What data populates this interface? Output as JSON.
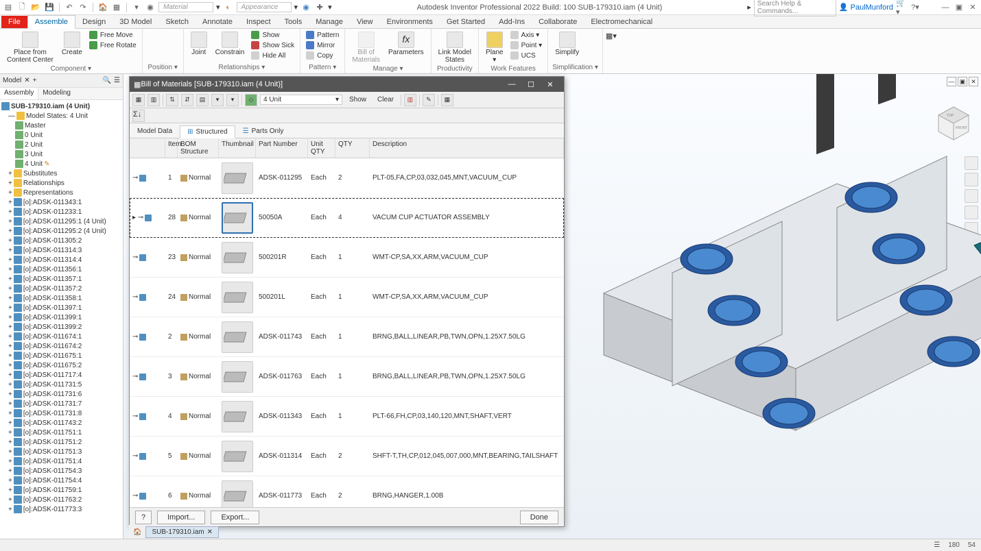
{
  "qat": {
    "material_placeholder": "Material",
    "appearance_label": "Appearance",
    "title": "Autodesk Inventor Professional 2022 Build: 100   SUB-179310.iam (4 Unit)",
    "search_placeholder": "Search Help & Commands...",
    "user": "PaulMunford"
  },
  "tabs": [
    "File",
    "Assemble",
    "Design",
    "3D Model",
    "Sketch",
    "Annotate",
    "Inspect",
    "Tools",
    "Manage",
    "View",
    "Environments",
    "Get Started",
    "Add-Ins",
    "Collaborate",
    "Electromechanical"
  ],
  "active_tab": "Assemble",
  "ribbon": {
    "component": {
      "big": [
        "Place from\nContent Center",
        "Create"
      ],
      "small": [
        "Free Move",
        "Free Rotate"
      ],
      "label": "Component ▾"
    },
    "position": {
      "label": "Position ▾"
    },
    "relationships": {
      "big": [
        "Joint",
        "Constrain"
      ],
      "small": [
        "Show",
        "Show Sick",
        "Hide All"
      ],
      "label": "Relationships ▾"
    },
    "pattern": {
      "small": [
        "Pattern",
        "Mirror",
        "Copy"
      ],
      "label": "Pattern ▾"
    },
    "manage": {
      "big": [
        "Bill of\nMaterials",
        "Parameters"
      ],
      "label": "Manage ▾"
    },
    "productivity": {
      "big": [
        "Link Model\nStates"
      ],
      "label": "Productivity"
    },
    "workfeat": {
      "big": [
        "Plane\n▾"
      ],
      "small": [
        "Axis ▾",
        "Point ▾",
        "UCS"
      ],
      "label": "Work Features"
    },
    "simplify": {
      "big": [
        "Simplify"
      ],
      "label": "Simplification ▾"
    }
  },
  "browser": {
    "head": "Model",
    "tabs": [
      "Assembly",
      "Modeling"
    ],
    "root": "SUB-179310.iam (4 Unit)",
    "modelstates": {
      "label": "Model States: 4 Unit",
      "items": [
        "Master",
        "0 Unit",
        "2 Unit",
        "3 Unit",
        "4 Unit"
      ]
    },
    "folders": [
      "Substitutes",
      "Relationships",
      "Representations"
    ],
    "parts": [
      "[o]:ADSK-011343:1",
      "[o]:ADSK-011233:1",
      "[o]:ADSK-011295:1 (4 Unit)",
      "[o]:ADSK-011295:2 (4 Unit)",
      "[o]:ADSK-011305:2",
      "[o]:ADSK-011314:3",
      "[o]:ADSK-011314:4",
      "[o]:ADSK-011356:1",
      "[o]:ADSK-011357:1",
      "[o]:ADSK-011357:2",
      "[o]:ADSK-011358:1",
      "[o]:ADSK-011397:1",
      "[o]:ADSK-011399:1",
      "[o]:ADSK-011399:2",
      "[o]:ADSK-011674:1",
      "[o]:ADSK-011674:2",
      "[o]:ADSK-011675:1",
      "[o]:ADSK-011675:2",
      "[o]:ADSK-011717:4",
      "[o]:ADSK-011731:5",
      "[o]:ADSK-011731:6",
      "[o]:ADSK-011731:7",
      "[o]:ADSK-011731:8",
      "[o]:ADSK-011743:2",
      "[o]:ADSK-011751:1",
      "[o]:ADSK-011751:2",
      "[o]:ADSK-011751:3",
      "[o]:ADSK-011751:4",
      "[o]:ADSK-011754:3",
      "[o]:ADSK-011754:4",
      "[o]:ADSK-011759:1",
      "[o]:ADSK-011763:2",
      "[o]:ADSK-011773:3"
    ]
  },
  "bom": {
    "title": "Bill of Materials [SUB-179310.iam (4 Unit)]",
    "unit_selector": "4 Unit",
    "show": "Show",
    "clear": "Clear",
    "viewtabs": [
      "Model Data",
      "Structured",
      "Parts Only"
    ],
    "active_view": "Structured",
    "cols": [
      "Item",
      "BOM Structure",
      "Thumbnail",
      "Part Number",
      "Unit QTY",
      "QTY",
      "Description"
    ],
    "rows": [
      {
        "item": "1",
        "bom": "Normal",
        "pn": "ADSK-011295",
        "uqty": "Each",
        "qty": "2",
        "desc": "PLT-05,FA,CP,03,032,045,MNT,VACUUM_CUP"
      },
      {
        "item": "28",
        "bom": "Normal",
        "pn": "50050A",
        "uqty": "Each",
        "qty": "4",
        "desc": "VACUM CUP ACTUATOR ASSEMBLY",
        "selected": true
      },
      {
        "item": "23",
        "bom": "Normal",
        "pn": "500201R",
        "uqty": "Each",
        "qty": "1",
        "desc": "WMT-CP,SA,XX,ARM,VACUUM_CUP"
      },
      {
        "item": "24",
        "bom": "Normal",
        "pn": "500201L",
        "uqty": "Each",
        "qty": "1",
        "desc": "WMT-CP,SA,XX,ARM,VACUUM_CUP"
      },
      {
        "item": "2",
        "bom": "Normal",
        "pn": "ADSK-011743",
        "uqty": "Each",
        "qty": "1",
        "desc": "BRNG,BALL,LINEAR,PB,TWN,OPN,1.25X7.50LG"
      },
      {
        "item": "3",
        "bom": "Normal",
        "pn": "ADSK-011763",
        "uqty": "Each",
        "qty": "1",
        "desc": "BRNG,BALL,LINEAR,PB,TWN,OPN,1.25X7.50LG"
      },
      {
        "item": "4",
        "bom": "Normal",
        "pn": "ADSK-011343",
        "uqty": "Each",
        "qty": "1",
        "desc": "PLT-66,FH,CP,03,140,120,MNT,SHAFT,VERT"
      },
      {
        "item": "5",
        "bom": "Normal",
        "pn": "ADSK-011314",
        "uqty": "Each",
        "qty": "2",
        "desc": "SHFT-T,TH,CP,012,045,007,000,MNT,BEARING,TAILSHAFT"
      },
      {
        "item": "6",
        "bom": "Normal",
        "pn": "ADSK-011773",
        "uqty": "Each",
        "qty": "2",
        "desc": "BRNG,HANGER,1.00B"
      }
    ],
    "footer": {
      "import": "Import...",
      "export": "Export...",
      "done": "Done"
    }
  },
  "doctab": "SUB-179310.iam",
  "status": {
    "x": "180",
    "y": "54"
  }
}
